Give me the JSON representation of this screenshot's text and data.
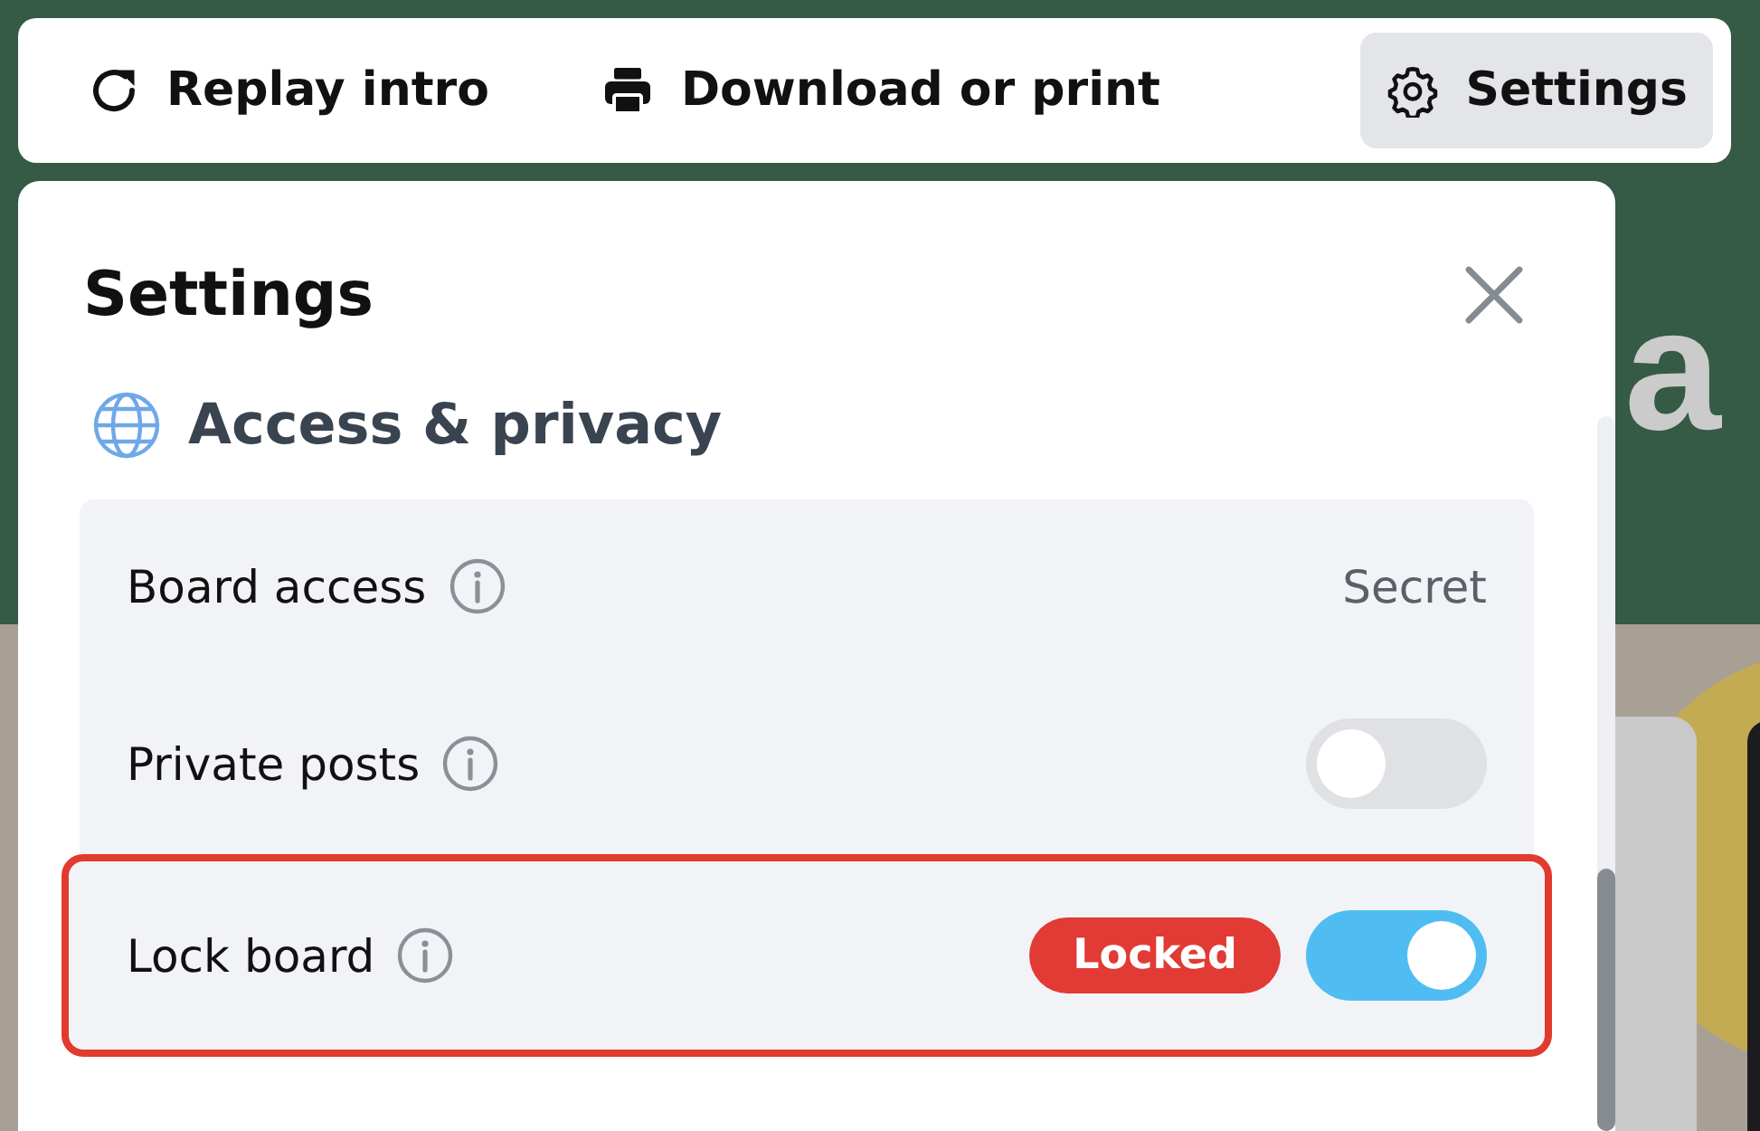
{
  "background": {
    "text": "a"
  },
  "toolbar": {
    "buttons": [
      {
        "label": "Replay intro",
        "selected": false
      },
      {
        "label": "Download or print",
        "selected": false
      },
      {
        "label": "Settings",
        "selected": true
      }
    ]
  },
  "panel": {
    "title": "Settings",
    "section": {
      "title": "Access & privacy",
      "rows": [
        {
          "label": "Board access",
          "kind": "value",
          "value": "Secret",
          "highlighted": false
        },
        {
          "label": "Private posts",
          "kind": "toggle",
          "on": false,
          "highlighted": false
        },
        {
          "label": "Lock board",
          "kind": "toggle",
          "on": true,
          "badge": "Locked",
          "highlighted": true
        }
      ]
    }
  }
}
